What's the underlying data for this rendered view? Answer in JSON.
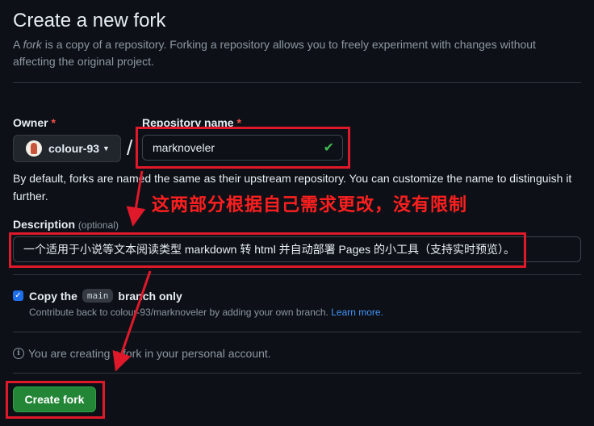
{
  "page": {
    "title": "Create a new fork",
    "subtitle_prefix": "A ",
    "subtitle_em": "fork",
    "subtitle_suffix": " is a copy of a repository. Forking a repository allows you to freely experiment with changes without affecting the original project."
  },
  "form": {
    "owner_label": "Owner",
    "repo_label": "Repository name",
    "required_mark": "*",
    "owner_value": "colour-93",
    "slash": "/",
    "repo_value": "marknoveler",
    "helper": "By default, forks are named the same as their upstream repository. You can customize the name to distinguish it further.",
    "description_label": "Description",
    "description_optional": "(optional)",
    "description_value": "一个适用于小说等文本阅读类型 markdown 转 html 并自动部署 Pages 的小工具（支持实时预览）。",
    "copy_label_prefix": "Copy the",
    "copy_branch": "main",
    "copy_label_suffix": "branch only",
    "copy_checked": true,
    "contrib_text": "Contribute back to colour-93/marknoveler by adding your own branch.",
    "learn_more": "Learn more.",
    "info_text": "You are creating a fork in your personal account.",
    "create_button": "Create fork"
  },
  "annotation": {
    "text": "这两部分根据自己需求更改，没有限制",
    "color": "#e0192a"
  },
  "icons": {
    "owner_avatar": "avatar",
    "owner_caret": "chevron-down-icon",
    "repo_valid": "check-icon",
    "info": "info-icon",
    "checkbox": "checkbox-checked"
  },
  "colors": {
    "background": "#0d1117",
    "primary_button": "#238636",
    "link": "#4493f8",
    "valid": "#3fb950",
    "required": "#f85149"
  }
}
